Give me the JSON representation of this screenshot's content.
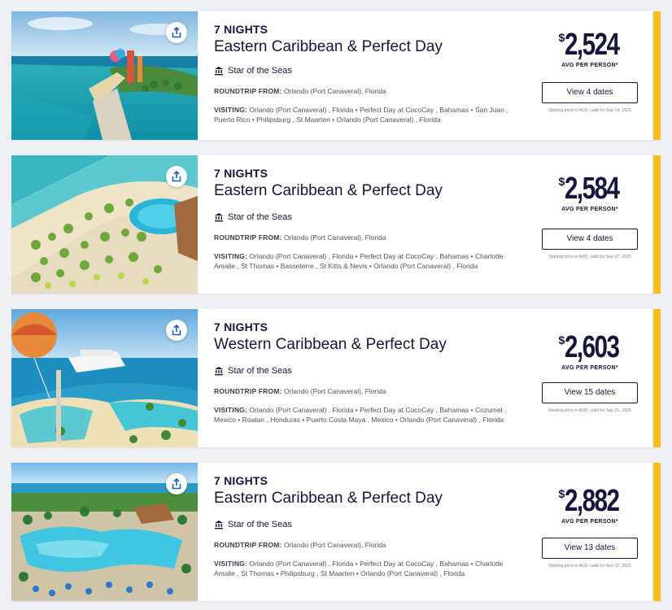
{
  "colors": {
    "accent": "#f8bd1c",
    "navy": "#15173c"
  },
  "cruises": [
    {
      "nights": "7 NIGHTS",
      "title": "Eastern Caribbean & Perfect Day",
      "ship": "Star of the Seas",
      "roundtrip_label": "ROUNDTRIP FROM:",
      "roundtrip_value": "Orlando (Port Canaveral), Florida",
      "visiting_label": "VISITING:",
      "visiting_value": "Orlando (Port Canaveral) , Florida • Perfect Day at CocoCay , Bahamas • San Juan , Puerto Rico • Philipsburg , St Maarten • Orlando (Port Canaveral) , Florida",
      "currency": "$",
      "price": "2,524",
      "price_label": "AVG PER PERSON*",
      "button": "View 4 dates",
      "note": "Starting price in AUD, valid for Sep 14, 2025"
    },
    {
      "nights": "7 NIGHTS",
      "title": "Eastern Caribbean & Perfect Day",
      "ship": "Star of the Seas",
      "roundtrip_label": "ROUNDTRIP FROM:",
      "roundtrip_value": "Orlando (Port Canaveral), Florida",
      "visiting_label": "VISITING:",
      "visiting_value": "Orlando (Port Canaveral) , Florida • Perfect Day at CocoCay , Bahamas • Charlotte Amalie , St Thomas • Basseterre , St Kitts & Nevis • Orlando (Port Canaveral) , Florida",
      "currency": "$",
      "price": "2,584",
      "price_label": "AVG PER PERSON*",
      "button": "View 4 dates",
      "note": "Starting price in AUD, valid for Sep 07, 2025"
    },
    {
      "nights": "7 NIGHTS",
      "title": "Western Caribbean & Perfect Day",
      "ship": "Star of the Seas",
      "roundtrip_label": "ROUNDTRIP FROM:",
      "roundtrip_value": "Orlando (Port Canaveral), Florida",
      "visiting_label": "VISITING:",
      "visiting_value": "Orlando (Port Canaveral) , Florida • Perfect Day at CocoCay , Bahamas • Cozumel , Mexico • Roatan , Honduras • Puerto Costa Maya , Mexico • Orlando (Port Canaveral) , Florida",
      "currency": "$",
      "price": "2,603",
      "price_label": "AVG PER PERSON*",
      "button": "View 15 dates",
      "note": "Starting price in AUD, valid for Sep 21, 2025"
    },
    {
      "nights": "7 NIGHTS",
      "title": "Eastern Caribbean & Perfect Day",
      "ship": "Star of the Seas",
      "roundtrip_label": "ROUNDTRIP FROM:",
      "roundtrip_value": "Orlando (Port Canaveral), Florida",
      "visiting_label": "VISITING:",
      "visiting_value": "Orlando (Port Canaveral) , Florida • Perfect Day at CocoCay , Bahamas • Charlotte Amalie , St Thomas • Philipsburg , St Maarten • Orlando (Port Canaveral) , Florida",
      "currency": "$",
      "price": "2,882",
      "price_label": "AVG PER PERSON*",
      "button": "View 13 dates",
      "note": "Starting price in AUD, valid for Nov 02, 2025"
    }
  ]
}
